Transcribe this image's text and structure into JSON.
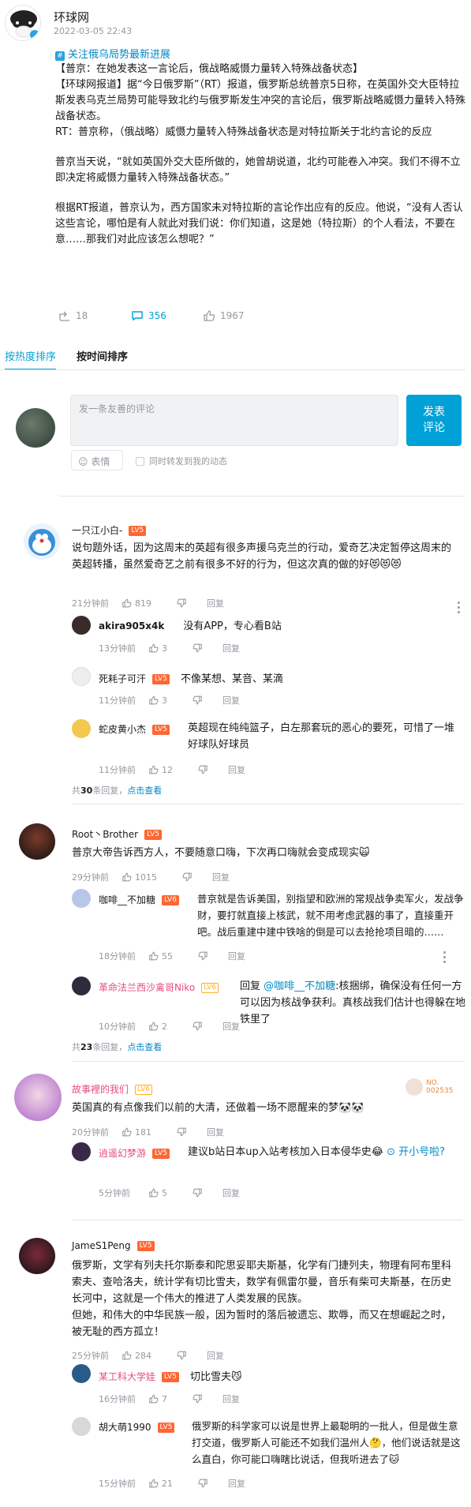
{
  "header": {
    "name": "环球网",
    "time": "2022-03-05 22:43",
    "topic": "关注俄乌局势最新进展"
  },
  "post": {
    "lines": [
      "【普京：在她发表这一言论后，俄战略威慑力量转入特殊战备状态】",
      "【环球网报道】据“今日俄罗斯”（RT）报道，俄罗斯总统普京5日称，在英国外交大臣特拉斯发表乌克兰局势可能导致北约与俄罗斯发生冲突的言论后，俄罗斯战略威慑力量转入特殊战备状态。",
      "RT：普京称，（俄战略）威慑力量转入特殊战备状态是对特拉斯关于北约言论的反应",
      "普京当天说，“就如英国外交大臣所做的，她曾胡说道，北约可能卷入冲突。我们不得不立即决定将威慑力量转入特殊战备状态。”",
      "根据RT报道，普京认为，西方国家未对特拉斯的言论作出应有的反应。他说，“没有人否认这些言论，哪怕是有人就此对我们说：你们知道，这是她（特拉斯）的个人看法，不要在意……那我们对此应该怎么想呢？”"
    ]
  },
  "stats": {
    "forward": "18",
    "comment": "356",
    "like": "1967"
  },
  "tabs": {
    "hot": "按热度排序",
    "time": "按时间排序"
  },
  "composer": {
    "placeholder": "发一条友善的评论",
    "send_line1": "发表",
    "send_line2": "评论",
    "emoji": "表情",
    "sync": "同时转发到我的动态"
  },
  "labels": {
    "reply": "回复",
    "total_prefix": "共",
    "total_suffix": "条回复，",
    "click_view": "点击查看",
    "reply_to": "回复 ",
    "lv": "LV5",
    "lv6": "LV6"
  },
  "comments": [
    {
      "user": "一只江小白-",
      "text": "说句题外话，因为这周末的英超有很多声援乌克兰的行动，爱奇艺决定暂停这周末的英超转播，虽然爱奇艺之前有很多不好的行为，但这次真的做的好😻😻😻",
      "time": "21分钟前",
      "likes": "819",
      "replies": [
        {
          "user": "akira905x4k",
          "text": "没有APP，专心看B站",
          "time": "13分钟前",
          "likes": "3"
        },
        {
          "user": "死耗子可汗",
          "text": "不像某想、某音、某滴",
          "time": "11分钟前",
          "likes": "3"
        },
        {
          "user": "蛇皮黄小杰",
          "text": "英超现在纯纯篮子，白左那套玩的恶心的要死，可惜了一堆好球队好球员",
          "time": "11分钟前",
          "likes": "12"
        }
      ],
      "total": "30"
    },
    {
      "user": "Root丶Brother",
      "text": "普京大帝告诉西方人，不要随意口嗨，下次再口嗨就会变成现实🙀",
      "time": "29分钟前",
      "likes": "1015",
      "replies": [
        {
          "user": "咖啡__不加糖",
          "text": "普京就是告诉美国，别指望和欧洲的常规战争卖军火，发战争财，要打就直接上核武，就不用考虑武器的事了，直接重开吧。战后重建中建中铁啥的倒是可以去抢抢项目暗的……",
          "time": "18分钟前",
          "likes": "55"
        },
        {
          "user": "革命法兰西沙禽哥Niko",
          "mention": "@咖啡__不加糖",
          "text": ":核捆绑，确保没有任何一方可以因为核战争获利。真核战我们估计也得躲在地铁里了",
          "time": "10分钟前",
          "likes": "2"
        }
      ],
      "total": "23"
    },
    {
      "user": "故事裡的我们",
      "badge": "NO. 002535",
      "text": "英国真的有点像我们以前的大清，还做着一场不愿醒来的梦🐼🐼",
      "time": "20分钟前",
      "likes": "181",
      "replies": [
        {
          "user": "逍遥幻梦游",
          "text": "建议b站日本up入站考核加入日本侵华史😂",
          "link": "开小号啦?",
          "time": "5分钟前",
          "likes": "5"
        }
      ]
    },
    {
      "user": "JameS1Peng",
      "text": "俄罗斯，文学有列夫托尔斯泰和陀思妥耶夫斯基，化学有门捷列夫，物理有阿布里科索夫、查哈洛夫，统计学有切比雪夫，数学有佩雷尔曼，音乐有柴可夫斯基，在历史长河中，这就是一个伟大的推进了人类发展的民族。\n但她，和伟大的中华民族一般，因为暂时的落后被遗忘、欺辱，而又在想崛起之时，被无耻的西方孤立！",
      "time": "25分钟前",
      "likes": "284",
      "replies": [
        {
          "user": "某工科大学娃",
          "text": "切比雪夫😼",
          "time": "16分钟前",
          "likes": "7"
        },
        {
          "user": "胡大萌1990",
          "text": "俄罗斯的科学家可以说是世界上最聪明的一批人，但是做生意打交道，俄罗斯人可能还不如我们温州人🤔，他们说话就是这么直白，你可能口嗨瞎比说话，但我听进去了🐱",
          "time": "15分钟前",
          "likes": "21"
        }
      ]
    }
  ]
}
